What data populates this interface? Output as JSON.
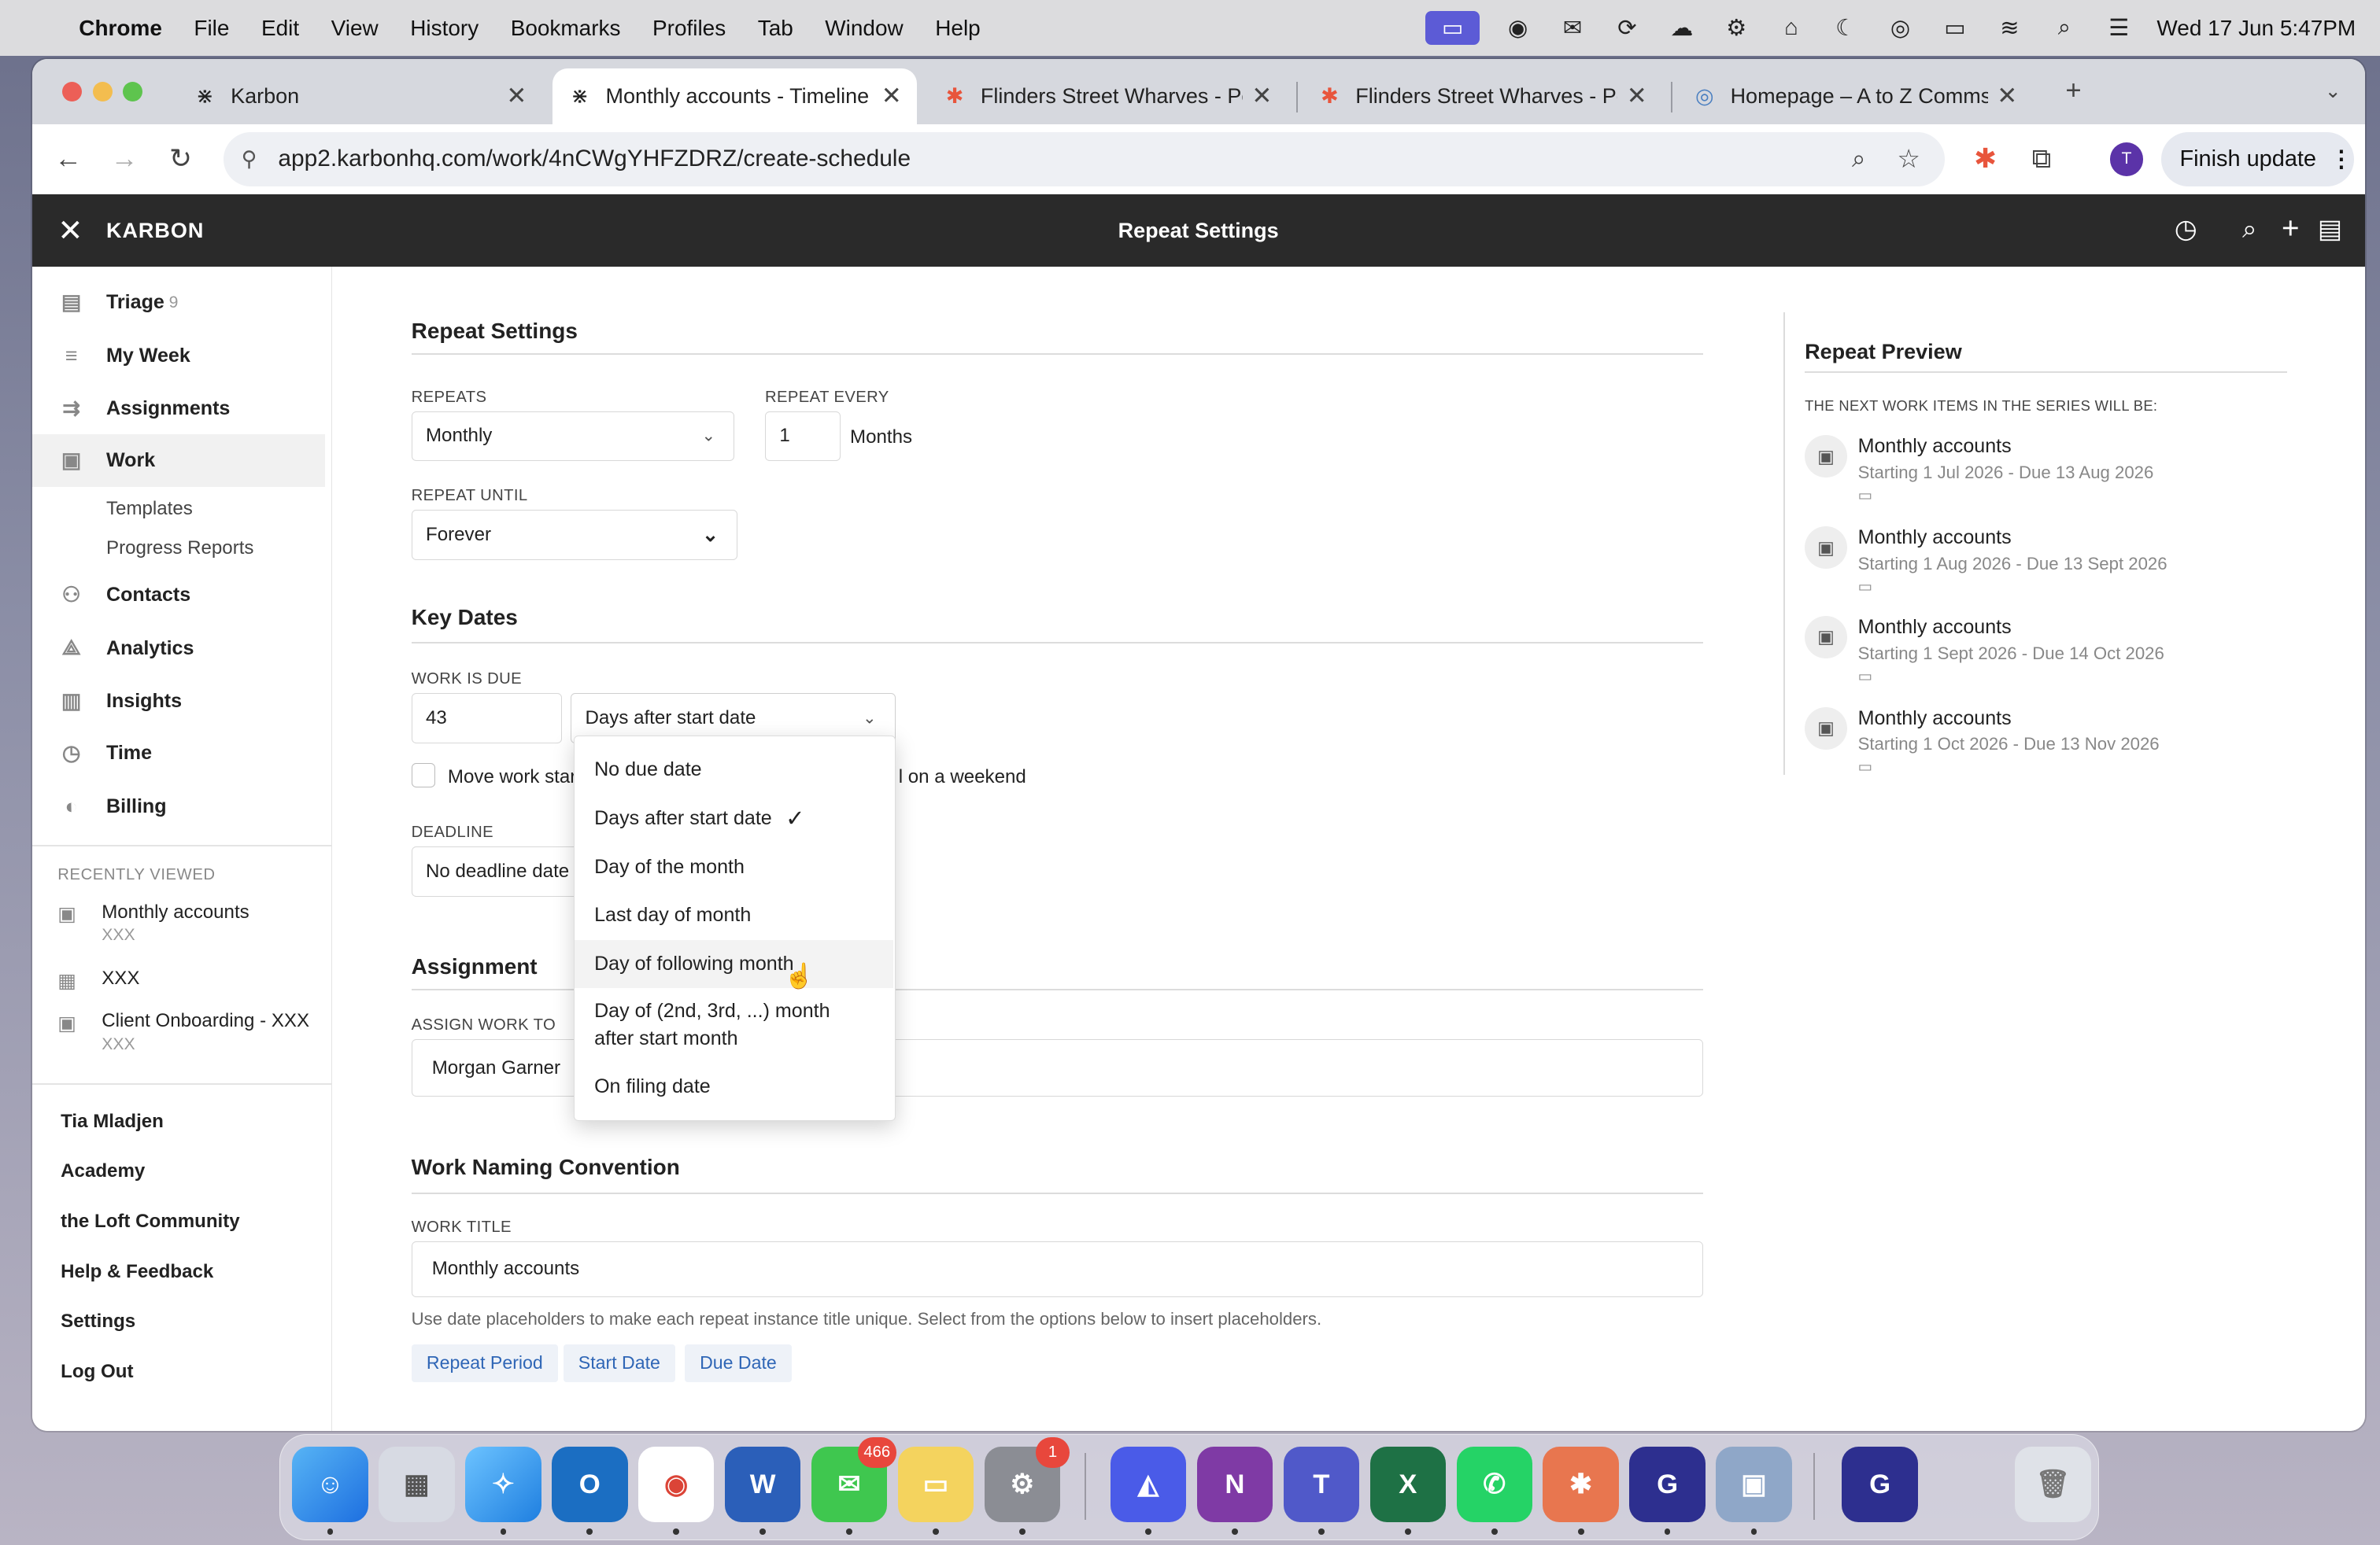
{
  "menubar": {
    "app": "Chrome",
    "items": [
      "File",
      "Edit",
      "View",
      "History",
      "Bookmarks",
      "Profiles",
      "Tab",
      "Window",
      "Help"
    ],
    "clock": "Wed 17 Jun  5:47PM"
  },
  "tabs": [
    {
      "title": "Karbon"
    },
    {
      "title": "Monthly accounts - Timeline |"
    },
    {
      "title": "Flinders Street Wharves - Pov"
    },
    {
      "title": "Flinders Street Wharves - Pov"
    },
    {
      "title": "Homepage – A to Z Comms &"
    }
  ],
  "toolbar": {
    "url": "app2.karbonhq.com/work/4nCWgYHFZDRZ/create-schedule",
    "profile_initial": "T",
    "finish_update": "Finish update"
  },
  "app": {
    "brand": "KARBON",
    "header_title": "Repeat Settings"
  },
  "sidebar": {
    "nav": [
      {
        "label": "Triage",
        "count": "9"
      },
      {
        "label": "My Week"
      },
      {
        "label": "Assignments"
      },
      {
        "label": "Work"
      },
      {
        "label": "Contacts"
      },
      {
        "label": "Analytics"
      },
      {
        "label": "Insights"
      },
      {
        "label": "Time"
      },
      {
        "label": "Billing"
      }
    ],
    "work_sub": [
      "Templates",
      "Progress Reports"
    ],
    "recent_header": "RECENTLY VIEWED",
    "recent": [
      {
        "title": "Monthly accounts",
        "sub": "XXX"
      },
      {
        "title": "XXX",
        "sub": ""
      },
      {
        "title": "Client Onboarding - XXX",
        "sub": "XXX"
      }
    ],
    "footer": [
      "Tia Mladjen",
      "Academy",
      "the Loft Community",
      "Help & Feedback",
      "Settings",
      "Log Out"
    ]
  },
  "repeat": {
    "heading": "Repeat Settings",
    "repeats_label": "REPEATS",
    "repeats_value": "Monthly",
    "every_label": "REPEAT EVERY",
    "every_value": "1",
    "every_unit": "Months",
    "until_label": "REPEAT UNTIL",
    "until_value": "Forever"
  },
  "key_dates": {
    "heading": "Key Dates",
    "due_label": "WORK IS DUE",
    "due_value": "43",
    "due_type": "Days after start date",
    "move_text_a": "Move work start",
    "move_text_b": "l on a weekend",
    "deadline_label": "DEADLINE",
    "deadline_value": "No deadline date"
  },
  "dropdown": {
    "options": [
      "No due date",
      "Days after start date",
      "Day of the month",
      "Last day of month",
      "Day of following month",
      "Day of (2nd, 3rd, ...) month after start month",
      "On filing date"
    ],
    "selected": "Days after start date",
    "hovered": "Day of following month"
  },
  "assignment": {
    "heading": "Assignment",
    "label": "ASSIGN WORK TO",
    "value": "Morgan Garner"
  },
  "naming": {
    "heading": "Work Naming Convention",
    "label": "WORK TITLE",
    "value": "Monthly accounts",
    "help": "Use date placeholders to make each repeat instance title unique. Select from the options below to insert placeholders.",
    "placeholders": [
      "Repeat Period",
      "Start Date",
      "Due Date"
    ]
  },
  "preview": {
    "heading": "Repeat Preview",
    "subheading": "THE NEXT WORK ITEMS IN THE SERIES WILL BE:",
    "items": [
      {
        "title": "Monthly accounts",
        "dates": "Starting 1 Jul 2026 - Due 13 Aug 2026"
      },
      {
        "title": "Monthly accounts",
        "dates": "Starting 1 Aug 2026 - Due 13 Sept 2026"
      },
      {
        "title": "Monthly accounts",
        "dates": "Starting 1 Sept 2026 - Due 14 Oct 2026"
      },
      {
        "title": "Monthly accounts",
        "dates": "Starting 1 Oct 2026 - Due 13 Nov 2026"
      }
    ]
  },
  "dock": {
    "messages_badge": "466",
    "settings_badge": "1"
  }
}
